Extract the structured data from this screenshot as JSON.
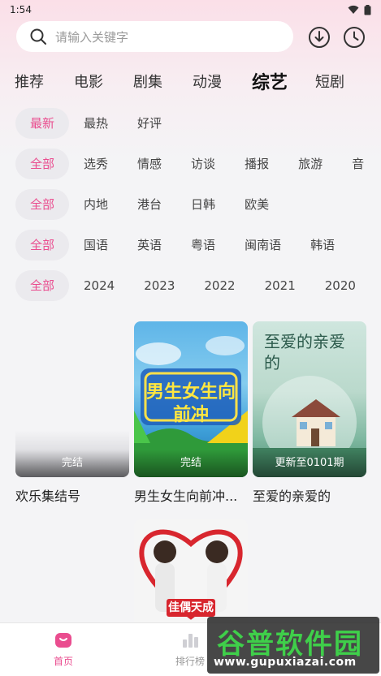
{
  "status": {
    "time": "1:54"
  },
  "search": {
    "placeholder": "请输入关键字"
  },
  "categories": [
    "推荐",
    "电影",
    "剧集",
    "动漫",
    "综艺",
    "短剧"
  ],
  "filters": {
    "sort": [
      "最新",
      "最热",
      "好评"
    ],
    "type": [
      "全部",
      "选秀",
      "情感",
      "访谈",
      "播报",
      "旅游",
      "音"
    ],
    "region": [
      "全部",
      "内地",
      "港台",
      "日韩",
      "欧美"
    ],
    "language": [
      "全部",
      "国语",
      "英语",
      "粤语",
      "闽南语",
      "韩语"
    ],
    "year": [
      "全部",
      "2024",
      "2023",
      "2022",
      "2021",
      "2020"
    ]
  },
  "cards": [
    {
      "title": "欢乐集结号",
      "badge": "完结"
    },
    {
      "title": "男生女生向前冲...",
      "badge": "完结",
      "poster_text": "男生女生向前冲"
    },
    {
      "title": "至爱的亲爱的",
      "badge": "更新至0101期",
      "poster_text": "至爱的亲爱的"
    },
    {
      "title": "",
      "poster_text": "佳偶天成"
    }
  ],
  "bottom_nav": [
    {
      "label": "首页",
      "active": true
    },
    {
      "label": "排行榜",
      "active": false
    }
  ],
  "watermark": {
    "title": "谷普软件园",
    "url": "www.gupuxiazai.com"
  },
  "colors": {
    "accent": "#ea4d8f",
    "chip_bg": "#ebeaee"
  }
}
